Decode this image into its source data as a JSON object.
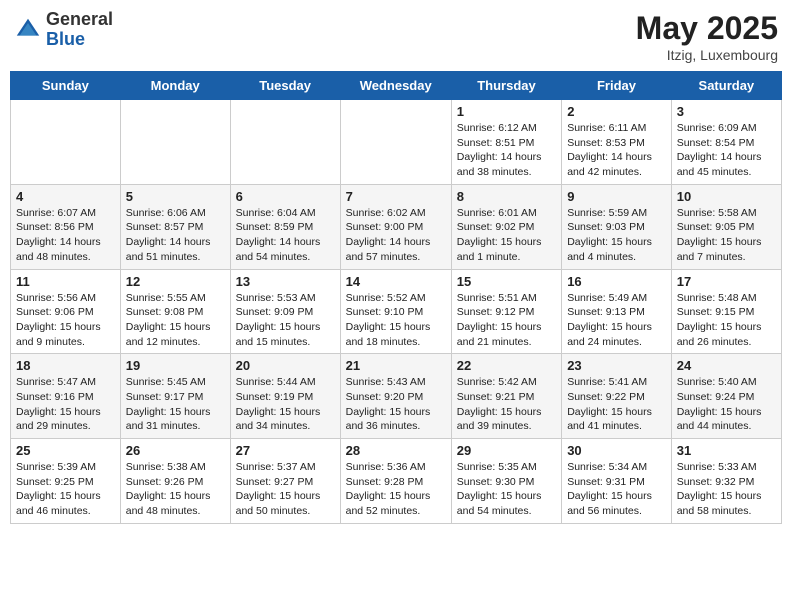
{
  "header": {
    "logo_general": "General",
    "logo_blue": "Blue",
    "month": "May 2025",
    "location": "Itzig, Luxembourg"
  },
  "weekdays": [
    "Sunday",
    "Monday",
    "Tuesday",
    "Wednesday",
    "Thursday",
    "Friday",
    "Saturday"
  ],
  "weeks": [
    [
      {
        "day": "",
        "info": ""
      },
      {
        "day": "",
        "info": ""
      },
      {
        "day": "",
        "info": ""
      },
      {
        "day": "",
        "info": ""
      },
      {
        "day": "1",
        "info": "Sunrise: 6:12 AM\nSunset: 8:51 PM\nDaylight: 14 hours\nand 38 minutes."
      },
      {
        "day": "2",
        "info": "Sunrise: 6:11 AM\nSunset: 8:53 PM\nDaylight: 14 hours\nand 42 minutes."
      },
      {
        "day": "3",
        "info": "Sunrise: 6:09 AM\nSunset: 8:54 PM\nDaylight: 14 hours\nand 45 minutes."
      }
    ],
    [
      {
        "day": "4",
        "info": "Sunrise: 6:07 AM\nSunset: 8:56 PM\nDaylight: 14 hours\nand 48 minutes."
      },
      {
        "day": "5",
        "info": "Sunrise: 6:06 AM\nSunset: 8:57 PM\nDaylight: 14 hours\nand 51 minutes."
      },
      {
        "day": "6",
        "info": "Sunrise: 6:04 AM\nSunset: 8:59 PM\nDaylight: 14 hours\nand 54 minutes."
      },
      {
        "day": "7",
        "info": "Sunrise: 6:02 AM\nSunset: 9:00 PM\nDaylight: 14 hours\nand 57 minutes."
      },
      {
        "day": "8",
        "info": "Sunrise: 6:01 AM\nSunset: 9:02 PM\nDaylight: 15 hours\nand 1 minute."
      },
      {
        "day": "9",
        "info": "Sunrise: 5:59 AM\nSunset: 9:03 PM\nDaylight: 15 hours\nand 4 minutes."
      },
      {
        "day": "10",
        "info": "Sunrise: 5:58 AM\nSunset: 9:05 PM\nDaylight: 15 hours\nand 7 minutes."
      }
    ],
    [
      {
        "day": "11",
        "info": "Sunrise: 5:56 AM\nSunset: 9:06 PM\nDaylight: 15 hours\nand 9 minutes."
      },
      {
        "day": "12",
        "info": "Sunrise: 5:55 AM\nSunset: 9:08 PM\nDaylight: 15 hours\nand 12 minutes."
      },
      {
        "day": "13",
        "info": "Sunrise: 5:53 AM\nSunset: 9:09 PM\nDaylight: 15 hours\nand 15 minutes."
      },
      {
        "day": "14",
        "info": "Sunrise: 5:52 AM\nSunset: 9:10 PM\nDaylight: 15 hours\nand 18 minutes."
      },
      {
        "day": "15",
        "info": "Sunrise: 5:51 AM\nSunset: 9:12 PM\nDaylight: 15 hours\nand 21 minutes."
      },
      {
        "day": "16",
        "info": "Sunrise: 5:49 AM\nSunset: 9:13 PM\nDaylight: 15 hours\nand 24 minutes."
      },
      {
        "day": "17",
        "info": "Sunrise: 5:48 AM\nSunset: 9:15 PM\nDaylight: 15 hours\nand 26 minutes."
      }
    ],
    [
      {
        "day": "18",
        "info": "Sunrise: 5:47 AM\nSunset: 9:16 PM\nDaylight: 15 hours\nand 29 minutes."
      },
      {
        "day": "19",
        "info": "Sunrise: 5:45 AM\nSunset: 9:17 PM\nDaylight: 15 hours\nand 31 minutes."
      },
      {
        "day": "20",
        "info": "Sunrise: 5:44 AM\nSunset: 9:19 PM\nDaylight: 15 hours\nand 34 minutes."
      },
      {
        "day": "21",
        "info": "Sunrise: 5:43 AM\nSunset: 9:20 PM\nDaylight: 15 hours\nand 36 minutes."
      },
      {
        "day": "22",
        "info": "Sunrise: 5:42 AM\nSunset: 9:21 PM\nDaylight: 15 hours\nand 39 minutes."
      },
      {
        "day": "23",
        "info": "Sunrise: 5:41 AM\nSunset: 9:22 PM\nDaylight: 15 hours\nand 41 minutes."
      },
      {
        "day": "24",
        "info": "Sunrise: 5:40 AM\nSunset: 9:24 PM\nDaylight: 15 hours\nand 44 minutes."
      }
    ],
    [
      {
        "day": "25",
        "info": "Sunrise: 5:39 AM\nSunset: 9:25 PM\nDaylight: 15 hours\nand 46 minutes."
      },
      {
        "day": "26",
        "info": "Sunrise: 5:38 AM\nSunset: 9:26 PM\nDaylight: 15 hours\nand 48 minutes."
      },
      {
        "day": "27",
        "info": "Sunrise: 5:37 AM\nSunset: 9:27 PM\nDaylight: 15 hours\nand 50 minutes."
      },
      {
        "day": "28",
        "info": "Sunrise: 5:36 AM\nSunset: 9:28 PM\nDaylight: 15 hours\nand 52 minutes."
      },
      {
        "day": "29",
        "info": "Sunrise: 5:35 AM\nSunset: 9:30 PM\nDaylight: 15 hours\nand 54 minutes."
      },
      {
        "day": "30",
        "info": "Sunrise: 5:34 AM\nSunset: 9:31 PM\nDaylight: 15 hours\nand 56 minutes."
      },
      {
        "day": "31",
        "info": "Sunrise: 5:33 AM\nSunset: 9:32 PM\nDaylight: 15 hours\nand 58 minutes."
      }
    ]
  ]
}
